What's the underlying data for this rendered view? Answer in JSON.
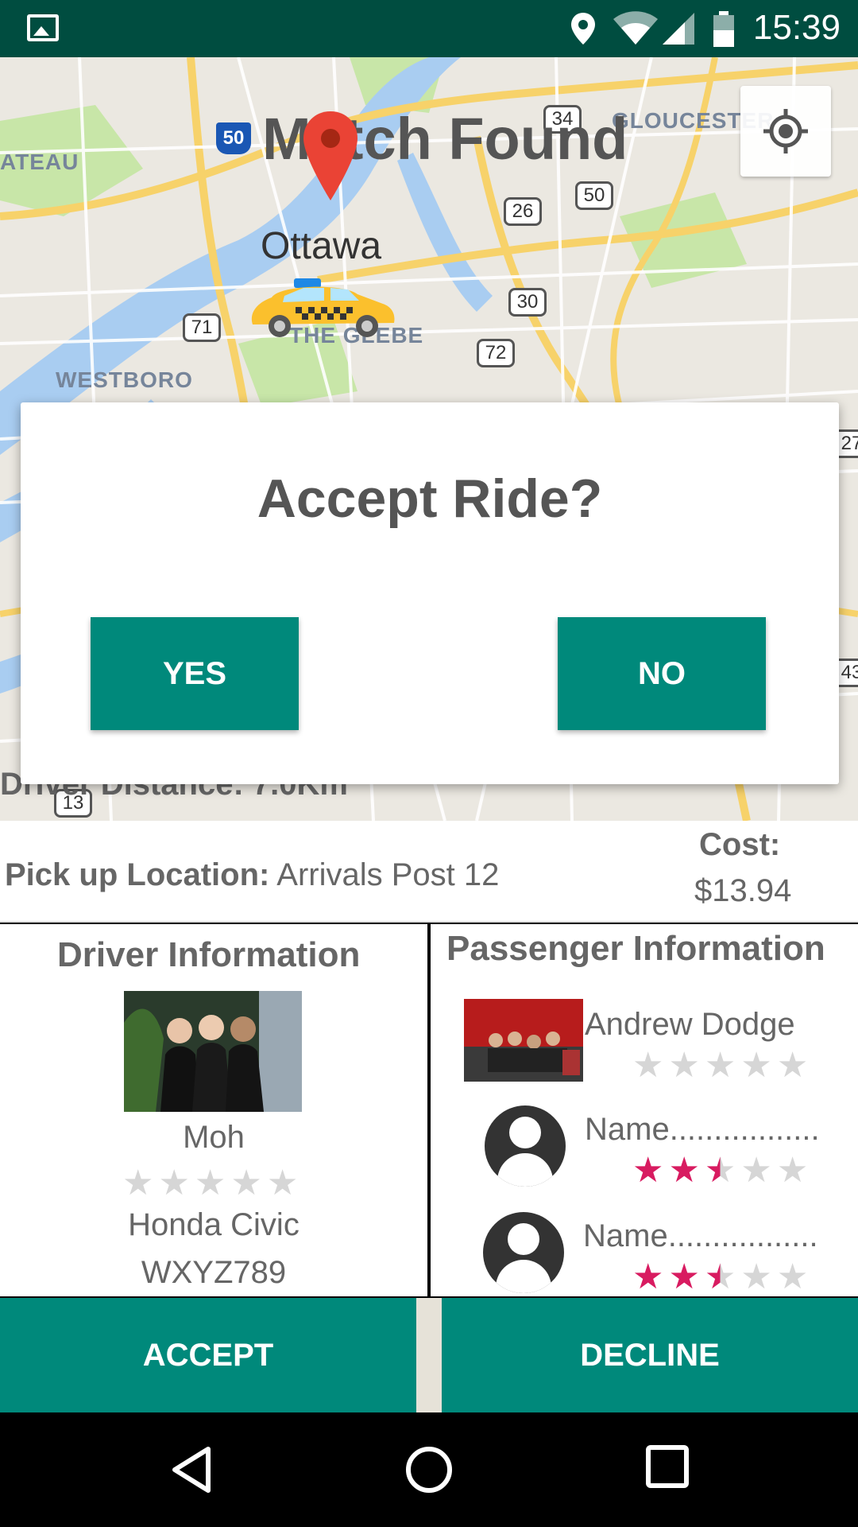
{
  "status_bar": {
    "time": "15:39",
    "icons": [
      "gallery-icon",
      "location-icon",
      "wifi-icon",
      "signal-icon",
      "battery-icon"
    ]
  },
  "map": {
    "title": "Match Found",
    "city_label": "Ottawa",
    "labels": {
      "gloucester": "GLOUCESTER",
      "westboro": "WESTBORO",
      "glebe": "THE GLEBE",
      "ateau": "ATEAU"
    },
    "route_shields": {
      "r50": "50",
      "r34": "34",
      "r26": "26",
      "r50b": "50",
      "r30": "30",
      "r71": "71",
      "r72": "72",
      "r13": "13",
      "r27": "27",
      "r43": "43"
    },
    "driver_distance": "Driver Distance:  7.0Km",
    "colors": {
      "water": "#a9cdf1",
      "park": "#c8e6a8",
      "road": "#f7d26a",
      "land": "#ebe8e1"
    }
  },
  "dialog": {
    "title": "Accept Ride?",
    "yes_label": "YES",
    "no_label": "NO"
  },
  "trip": {
    "pickup_label": "Pick up Location:",
    "pickup_value": "Arrivals Post 12",
    "cost_label": "Cost:",
    "cost_value": "$13.94"
  },
  "driver": {
    "title": "Driver Information",
    "name": "Moh",
    "rating": 0,
    "car": "Honda Civic",
    "plate": "WXYZ789"
  },
  "passengers": {
    "title": "Passenger Information",
    "list": [
      {
        "name": "Andrew Dodge",
        "rating": 0
      },
      {
        "name": "Name.................",
        "rating": 2.5
      },
      {
        "name": "Name.................",
        "rating": 2.5
      }
    ]
  },
  "actions": {
    "accept_label": "ACCEPT",
    "decline_label": "DECLINE",
    "accent": "#00897b"
  },
  "nav": {
    "icons": [
      "back-icon",
      "home-icon",
      "recents-icon"
    ]
  }
}
